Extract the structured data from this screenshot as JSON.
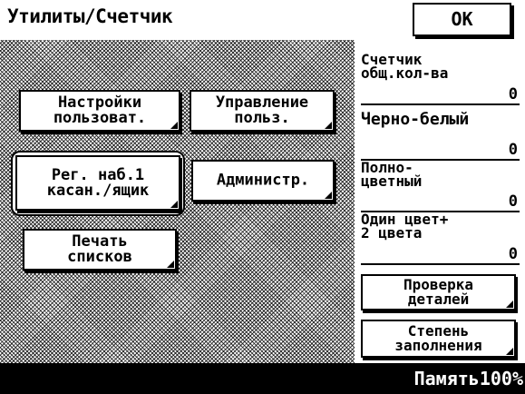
{
  "header": {
    "title": "Утилиты/Счетчик",
    "ok_label": "OK"
  },
  "menu": {
    "user_settings": "Настройки\nпользоват.",
    "user_management": "Управление\nпольз.",
    "onetouch_box": "Рег. наб.1\nкасан./ящик",
    "admin": "Администр.",
    "print_lists": "Печать\nсписков"
  },
  "counters": {
    "total_label": "Счетчик\nобщ.кол-ва",
    "total_value": "0",
    "bw_label": "Черно-белый",
    "bw_value": "0",
    "fullcolor_label": "Полно-\nцветный",
    "fullcolor_value": "0",
    "singlecolor_label": "Один цвет+\n2 цвета",
    "singlecolor_value": "0"
  },
  "side_buttons": {
    "check_details": "Проверка\nдеталей",
    "coverage": "Степень\nзаполнения"
  },
  "status": {
    "memory": "Память100%"
  }
}
